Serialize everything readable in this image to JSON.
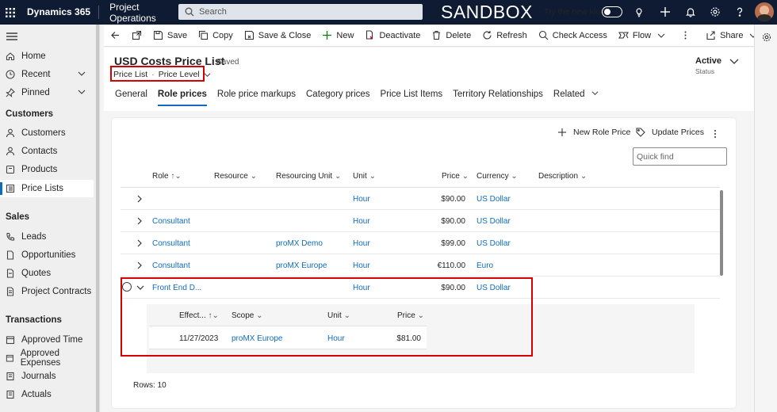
{
  "topbar": {
    "brand": "Dynamics 365",
    "app": "Project Operations",
    "search_placeholder": "Search",
    "environment": "SANDBOX",
    "try_new_look": "Try the new look"
  },
  "sidebar": {
    "items": [
      {
        "label": "Home",
        "icon": "home-icon"
      },
      {
        "label": "Recent",
        "icon": "clock-icon"
      },
      {
        "label": "Pinned",
        "icon": "pin-icon"
      }
    ],
    "sections": [
      {
        "title": "Customers",
        "items": [
          "Customers",
          "Contacts",
          "Products",
          "Price Lists"
        ]
      },
      {
        "title": "Sales",
        "items": [
          "Leads",
          "Opportunities",
          "Quotes",
          "Project Contracts"
        ]
      },
      {
        "title": "Transactions",
        "items": [
          "Approved Time",
          "Approved Expenses",
          "Journals",
          "Actuals"
        ]
      }
    ],
    "selected": "Price Lists"
  },
  "commands": [
    "Save",
    "Copy",
    "Save & Close",
    "New",
    "Deactivate",
    "Delete",
    "Refresh",
    "Check Access",
    "Flow",
    "Share"
  ],
  "record": {
    "title": "USD Costs Price List",
    "saved": "- Saved",
    "entity": "Price List",
    "form": "Price Level",
    "status_value": "Active",
    "status_label": "Status"
  },
  "tabs": [
    "General",
    "Role prices",
    "Role price markups",
    "Category prices",
    "Price List Items",
    "Territory Relationships",
    "Related"
  ],
  "grid": {
    "new_label": "New Role Price",
    "update_label": "Update Prices",
    "quick_find": "Quick find",
    "columns": [
      "Role",
      "Resource",
      "Resourcing Unit",
      "Unit",
      "Price",
      "Currency",
      "Description"
    ],
    "rows": [
      {
        "role": "",
        "resunit": "",
        "unit": "Hour",
        "price": "$90.00",
        "currency": "US Dollar"
      },
      {
        "role": "Consultant",
        "resunit": "",
        "unit": "Hour",
        "price": "$90.00",
        "currency": "US Dollar"
      },
      {
        "role": "Consultant",
        "resunit": "proMX Demo",
        "unit": "Hour",
        "price": "$99.00",
        "currency": "US Dollar"
      },
      {
        "role": "Consultant",
        "resunit": "proMX Europe",
        "unit": "Hour",
        "price": "€110.00",
        "currency": "Euro"
      },
      {
        "role": "Front End D...",
        "resunit": "",
        "unit": "Hour",
        "price": "$90.00",
        "currency": "US Dollar"
      }
    ],
    "sub_columns": [
      "Effect...",
      "Scope",
      "Unit",
      "Price"
    ],
    "sub_row": {
      "date": "11/27/2023",
      "scope": "proMX Europe",
      "unit": "Hour",
      "price": "$81.00"
    },
    "rows_footer": "Rows: 10"
  }
}
